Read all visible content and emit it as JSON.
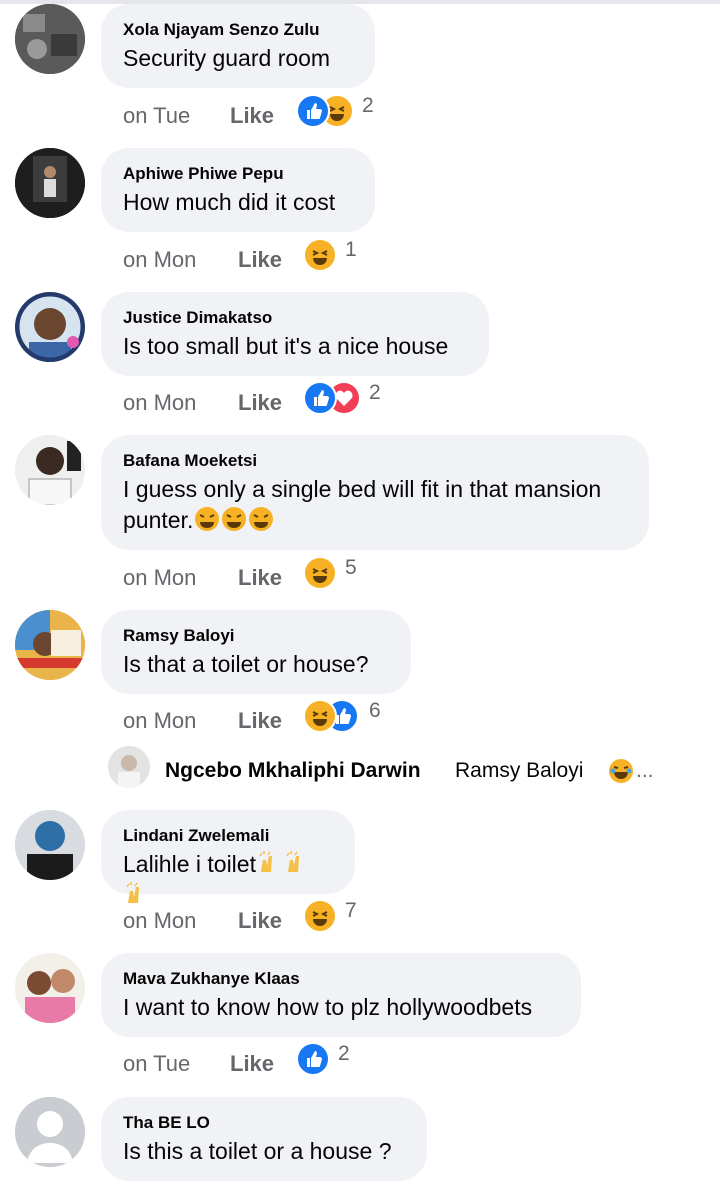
{
  "comments": [
    {
      "author": "Xola Njayam Senzo Zulu",
      "text": "Security guard room",
      "time": "on Tue",
      "like_label": "Like",
      "reactions": [
        "like",
        "haha"
      ],
      "reaction_count": "2"
    },
    {
      "author": "Aphiwe Phiwe Pepu",
      "text": "How much did it cost",
      "time": "on Mon",
      "like_label": "Like",
      "reactions": [
        "haha"
      ],
      "reaction_count": "1"
    },
    {
      "author": "Justice Dimakatso",
      "text": "Is too small but it's a nice house",
      "time": "on Mon",
      "like_label": "Like",
      "reactions": [
        "like",
        "love"
      ],
      "reaction_count": "2"
    },
    {
      "author": "Bafana Moeketsi",
      "text": "I guess only a single bed will fit in that mansion punter.",
      "time": "on Mon",
      "like_label": "Like",
      "reactions": [
        "haha"
      ],
      "reaction_count": "5"
    },
    {
      "author": "Ramsy Baloyi",
      "text": "Is that a toilet or house?",
      "time": "on Mon",
      "like_label": "Like",
      "reactions": [
        "haha",
        "like"
      ],
      "reaction_count": "6"
    },
    {
      "author": "Lindani Zwelemali",
      "text": "Lalihle i toilet",
      "time": "on Mon",
      "like_label": "Like",
      "reactions": [
        "haha"
      ],
      "reaction_count": "7"
    },
    {
      "author": "Mava Zukhanye Klaas",
      "text": "I want to know how to plz hollywoodbets",
      "time": "on Tue",
      "like_label": "Like",
      "reactions": [
        "like"
      ],
      "reaction_count": "2"
    },
    {
      "author": "Tha BE LO",
      "text": "Is this a toilet or a house ?"
    }
  ],
  "reply_preview": {
    "author": "Ngcebo Mkhaliphi Darwin",
    "text": "Ramsy Baloyi",
    "more": "..."
  },
  "colors": {
    "bubble": "#f0f2f5",
    "meta_text": "#65676b",
    "like_blue": "#1877f2",
    "haha_yellow": "#f7b125",
    "love_red": "#f33e58"
  }
}
